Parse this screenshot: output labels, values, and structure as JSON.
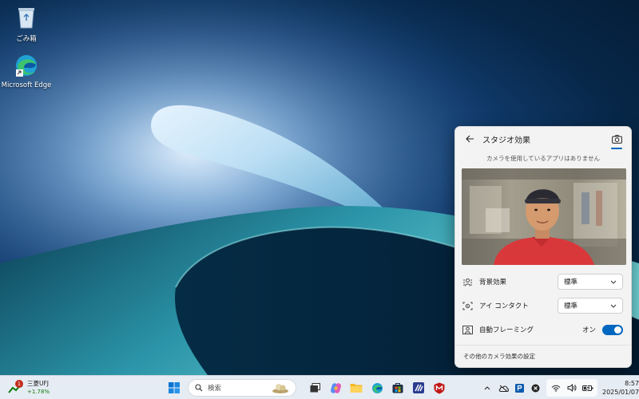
{
  "desktop": {
    "icons": [
      {
        "label": "ごみ箱",
        "icon": "recycle-bin-icon"
      },
      {
        "label": "Microsoft Edge",
        "icon": "edge-icon"
      }
    ]
  },
  "studio_panel": {
    "title": "スタジオ効果",
    "notice": "カメラを使用しているアプリはありません",
    "settings": [
      {
        "label": "背景効果",
        "value": "標準",
        "icon": "background-effect-icon"
      },
      {
        "label": "アイ コンタクト",
        "value": "標準",
        "icon": "eye-contact-icon"
      },
      {
        "label": "自動フレーミング",
        "toggle_label": "オン",
        "toggle_on": true,
        "icon": "auto-framing-icon"
      }
    ],
    "footer": "その他のカメラ効果の設定"
  },
  "taskbar": {
    "stock": {
      "name": "三菱UFJ",
      "change": "+1.78%",
      "badge": "1"
    },
    "search_placeholder": "検索",
    "apps": [
      "start-icon",
      "task-view-icon",
      "copilot-icon",
      "file-explorer-icon",
      "edge-icon",
      "store-icon",
      "vscode-icon",
      "mcafee-icon"
    ],
    "tray": [
      "show-hidden-icons-icon",
      "onedrive-icon",
      "app-tray-icon",
      "close-app-icon"
    ],
    "time": "8:57",
    "date": "2025/01/07"
  },
  "colors": {
    "accent": "#0067c0",
    "panel_bg": "#f3f3f3",
    "taskbar_bg": "#e6ecf3"
  }
}
